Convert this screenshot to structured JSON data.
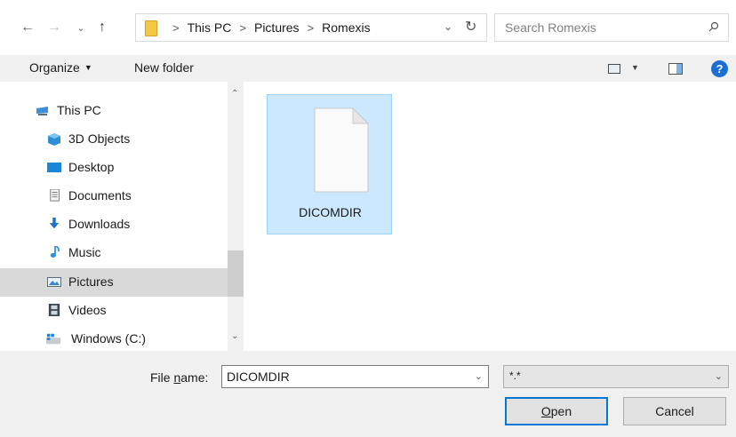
{
  "nav": {
    "back_icon": "arrow-left-icon",
    "forward_icon": "arrow-right-icon",
    "recent_icon": "chevron-down-icon",
    "up_icon": "arrow-up-icon"
  },
  "address": {
    "crumbs": [
      "This PC",
      "Pictures",
      "Romexis"
    ],
    "icon": "folder-icon"
  },
  "search": {
    "placeholder": "Search Romexis",
    "icon": "search-icon"
  },
  "toolbar": {
    "organize_label": "Organize",
    "new_folder_label": "New folder",
    "help_label": "?"
  },
  "sidebar": {
    "items": [
      {
        "label": "This PC",
        "icon": "pc-icon",
        "selected": false
      },
      {
        "label": "3D Objects",
        "icon": "3d-objects-icon",
        "selected": false
      },
      {
        "label": "Desktop",
        "icon": "desktop-icon",
        "selected": false
      },
      {
        "label": "Documents",
        "icon": "documents-icon",
        "selected": false
      },
      {
        "label": "Downloads",
        "icon": "downloads-icon",
        "selected": false
      },
      {
        "label": "Music",
        "icon": "music-icon",
        "selected": false
      },
      {
        "label": "Pictures",
        "icon": "pictures-icon",
        "selected": true
      },
      {
        "label": "Videos",
        "icon": "videos-icon",
        "selected": false
      },
      {
        "label": "Windows (C:)",
        "icon": "drive-icon",
        "selected": false
      }
    ]
  },
  "files": [
    {
      "name": "DICOMDIR",
      "icon": "file-icon",
      "selected": true
    }
  ],
  "bottom": {
    "file_name_label_prefix": "File ",
    "file_name_label_underlined": "n",
    "file_name_label_suffix": "ame:",
    "file_name_value": "DICOMDIR",
    "filter_value": "*.*",
    "open_label_underlined": "O",
    "open_label_rest": "pen",
    "cancel_label": "Cancel"
  },
  "colors": {
    "accent": "#0078d7",
    "selection_bg": "#cce8ff",
    "selection_border": "#99d1ff",
    "help_blue": "#1b6ed2"
  }
}
